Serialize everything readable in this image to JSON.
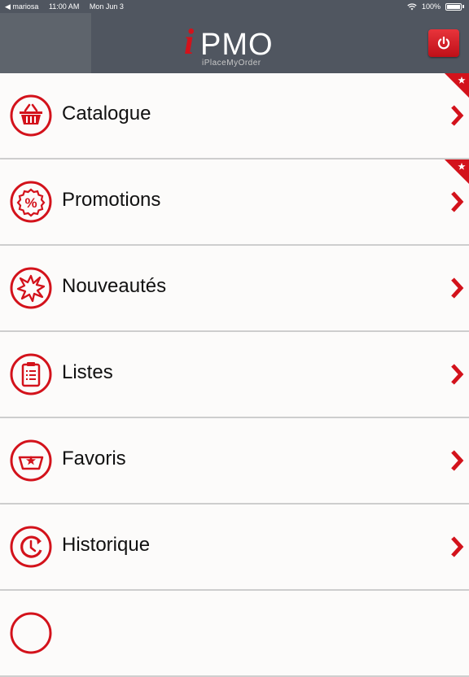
{
  "status_bar": {
    "back_app": "◀ mariosa",
    "time": "11:00 AM",
    "date": "Mon Jun 3",
    "battery": "100%"
  },
  "header": {
    "logo_i": "i",
    "logo_pmo": "PMO",
    "logo_sub": "iPlaceMyOrder",
    "power_icon": "power-icon"
  },
  "accent_color": "#d3121b",
  "menu": {
    "items": [
      {
        "label": "Catalogue",
        "icon": "basket-icon",
        "new_badge": true
      },
      {
        "label": "Promotions",
        "icon": "percent-badge-icon",
        "new_badge": true
      },
      {
        "label": "Nouveautés",
        "icon": "burst-icon",
        "new_badge": false
      },
      {
        "label": "Listes",
        "icon": "clipboard-list-icon",
        "new_badge": false
      },
      {
        "label": "Favoris",
        "icon": "basket-star-icon",
        "new_badge": false
      },
      {
        "label": "Historique",
        "icon": "history-icon",
        "new_badge": false
      },
      {
        "label": "",
        "icon": "partial-icon",
        "new_badge": false
      }
    ]
  }
}
